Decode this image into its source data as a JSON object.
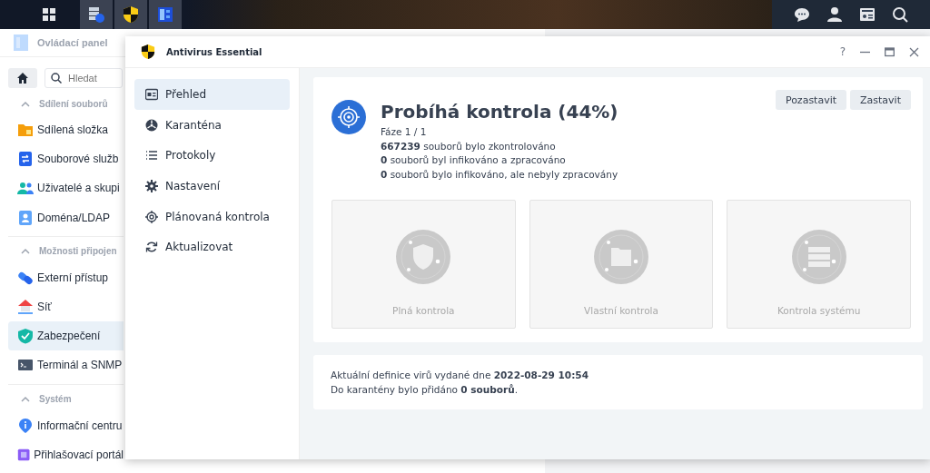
{
  "taskbar": {
    "apps": [
      {
        "selected": false
      },
      {
        "selected": true
      },
      {
        "selected": true
      },
      {
        "selected": true
      }
    ]
  },
  "control_panel": {
    "title": "Ovládací panel",
    "search": {
      "placeholder": "Hledat"
    },
    "sections": [
      {
        "label": "Sdílení souborů",
        "expanded": true,
        "items": [
          {
            "label": "Sdílená složka",
            "selected": false
          },
          {
            "label": "Souborové služb",
            "selected": false
          },
          {
            "label": "Uživatelé a skupi",
            "selected": false
          },
          {
            "label": "Doména/LDAP",
            "selected": false
          }
        ]
      },
      {
        "label": "Možnosti připojen",
        "expanded": true,
        "items": [
          {
            "label": "Externí přístup",
            "selected": false
          },
          {
            "label": "Síť",
            "selected": false
          },
          {
            "label": "Zabezpečení",
            "selected": true
          },
          {
            "label": "Terminál a SNMP",
            "selected": false
          }
        ]
      },
      {
        "label": "Systém",
        "expanded": true,
        "items": [
          {
            "label": "Informační centru",
            "selected": false
          },
          {
            "label": "Přihlašovací portál",
            "selected": false
          }
        ]
      }
    ]
  },
  "window": {
    "title": "Antivirus Essential",
    "controls": {
      "help": "?"
    },
    "nav": [
      {
        "label": "Přehled",
        "selected": true
      },
      {
        "label": "Karanténa",
        "selected": false
      },
      {
        "label": "Protokoly",
        "selected": false
      },
      {
        "label": "Nastavení",
        "selected": false
      },
      {
        "label": "Plánovaná kontrola",
        "selected": false
      },
      {
        "label": "Aktualizovat",
        "selected": false
      }
    ],
    "status": {
      "title": "Probíhá kontrola (44%)",
      "lines": [
        "Fáze 1 / 1",
        "**667239** souborů bylo zkontrolováno",
        "**0** souborů byl infikováno a zpracováno",
        "**0** souborů bylo infikováno, ale nebyly zpracovány"
      ],
      "buttons": [
        "Pozastavit",
        "Zastavit"
      ]
    },
    "scans": [
      {
        "label": "Plná kontrola",
        "disabled": true
      },
      {
        "label": "Vlastní kontrola",
        "disabled": true
      },
      {
        "label": "Kontrola systému",
        "disabled": true
      }
    ],
    "info": [
      "Aktuální definice virů vydané dne **2022-08-29 10:54**",
      "Do karantény bylo přidáno **0 souborů**."
    ]
  }
}
